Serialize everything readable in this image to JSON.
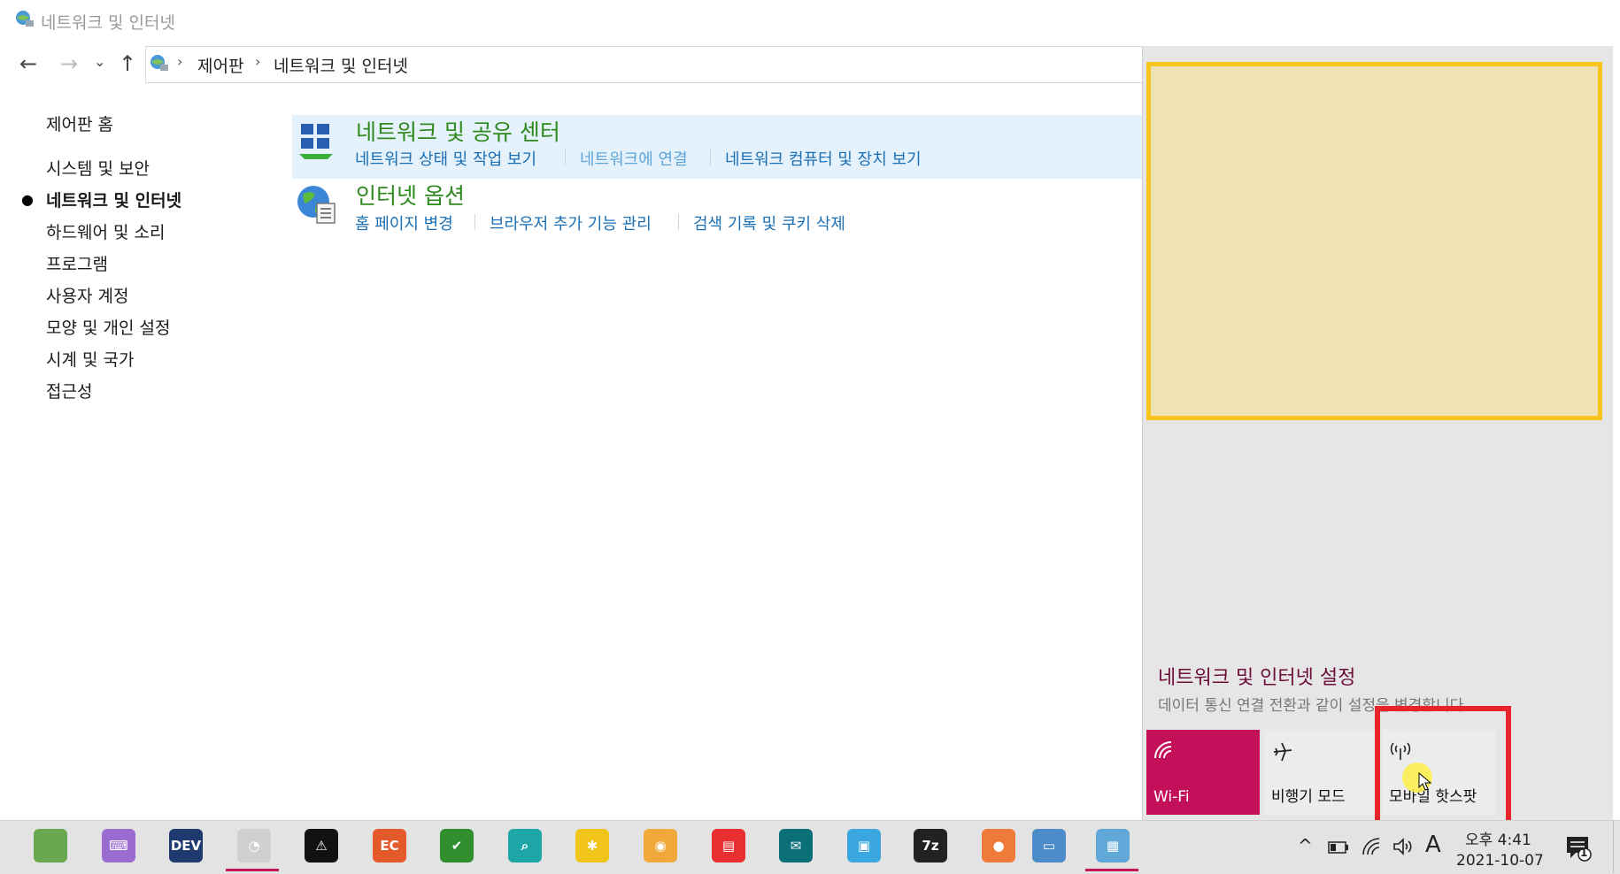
{
  "window": {
    "title": "네트워크 및 인터넷"
  },
  "nav": {
    "back": "←",
    "forward": "→",
    "recent": "⌄",
    "up": "↑"
  },
  "breadcrumb": {
    "items": [
      "제어판",
      "네트워크 및 인터넷"
    ],
    "separator": "›"
  },
  "left_nav": {
    "home": "제어판 홈",
    "items": [
      "시스템 및 보안",
      "네트워크 및 인터넷",
      "하드웨어 및 소리",
      "프로그램",
      "사용자 계정",
      "모양 및 개인 설정",
      "시계 및 국가",
      "접근성"
    ],
    "active_index": 1
  },
  "categories": [
    {
      "title": "네트워크 및 공유 센터",
      "links": [
        "네트워크 상태 및 작업 보기",
        "네트워크에 연결",
        "네트워크 컴퓨터 및 장치 보기"
      ]
    },
    {
      "title": "인터넷 옵션",
      "links": [
        "홈 페이지 변경",
        "브라우저 추가 기능 관리",
        "검색 기록 및 쿠키 삭제"
      ]
    }
  ],
  "action_center": {
    "title": "네트워크 및 인터넷 설정",
    "subtitle": "데이터 통신 연결 전환과 같이 설정을 변경합니다.",
    "tiles": [
      {
        "label": "Wi-Fi",
        "icon": "wifi-icon",
        "active": true,
        "bg": "#c4105a"
      },
      {
        "label": "비행기 모드",
        "icon": "airplane-icon",
        "active": false,
        "bg": "#ececec"
      },
      {
        "label": "모바일 핫스팟",
        "icon": "hotspot-icon",
        "active": false,
        "bg": "#ececec"
      }
    ]
  },
  "taskbar": {
    "apps": [
      {
        "icon": "green-speech-app-icon",
        "glyph": "",
        "color": "#6aa84f"
      },
      {
        "icon": "keyboard-app-icon",
        "glyph": "⌨",
        "color": "#9a6bd1"
      },
      {
        "icon": "dev-app-icon",
        "glyph": "DEV",
        "color": "#1e3a6e"
      },
      {
        "icon": "photoscape-icon",
        "glyph": "◔",
        "color": "#d0d0d0"
      },
      {
        "icon": "warning-app-icon",
        "glyph": "⚠",
        "color": "#111111"
      },
      {
        "icon": "ec-app-icon",
        "glyph": "EC",
        "color": "#e55a2a"
      },
      {
        "icon": "checklist-app-icon",
        "glyph": "✔",
        "color": "#2f8f2f"
      },
      {
        "icon": "search-app-icon",
        "glyph": "⌕",
        "color": "#1fa6a6"
      },
      {
        "icon": "puzzle-app-icon",
        "glyph": "✱",
        "color": "#f0c419"
      },
      {
        "icon": "paint-app-icon",
        "glyph": "◉",
        "color": "#f2a93b"
      },
      {
        "icon": "split-app-icon",
        "glyph": "▤",
        "color": "#e83030"
      },
      {
        "icon": "mail-app-icon",
        "glyph": "✉",
        "color": "#0a6f78"
      },
      {
        "icon": "screen-app-icon",
        "glyph": "▣",
        "color": "#3aa7e0"
      },
      {
        "icon": "7zip-icon",
        "glyph": "7z",
        "color": "#222222"
      },
      {
        "icon": "presentation-app-icon",
        "glyph": "●",
        "color": "#f07a3a"
      },
      {
        "icon": "image-viewer-icon",
        "glyph": "▭",
        "color": "#4c8ac8"
      },
      {
        "icon": "control-panel-icon",
        "glyph": "▦",
        "color": "#5fa8d8"
      }
    ],
    "tray": {
      "chevron": "^",
      "ime": "A"
    },
    "clock": {
      "time": "오후 4:41",
      "date": "2021-10-07"
    },
    "notification_count": "1"
  }
}
